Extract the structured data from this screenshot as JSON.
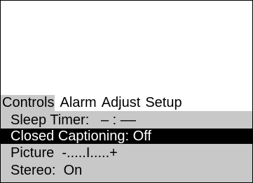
{
  "tabs": [
    {
      "label": "Controls",
      "active": true
    },
    {
      "label": "Alarm",
      "active": false
    },
    {
      "label": "Adjust",
      "active": false
    },
    {
      "label": "Setup",
      "active": false
    }
  ],
  "menu": {
    "items": [
      {
        "label": "Sleep Timer:",
        "value": "– : ––"
      },
      {
        "label": "Closed Captioning:",
        "value": "Off",
        "highlighted": true
      },
      {
        "label": "Picture",
        "value": "-.....I.....+"
      },
      {
        "label": "Stereo:",
        "value": "On"
      }
    ]
  },
  "colors": {
    "panel": "#c8c8c8",
    "highlight_bg": "#000000",
    "highlight_fg": "#ffffff",
    "text": "#000000",
    "background": "#ffffff"
  }
}
